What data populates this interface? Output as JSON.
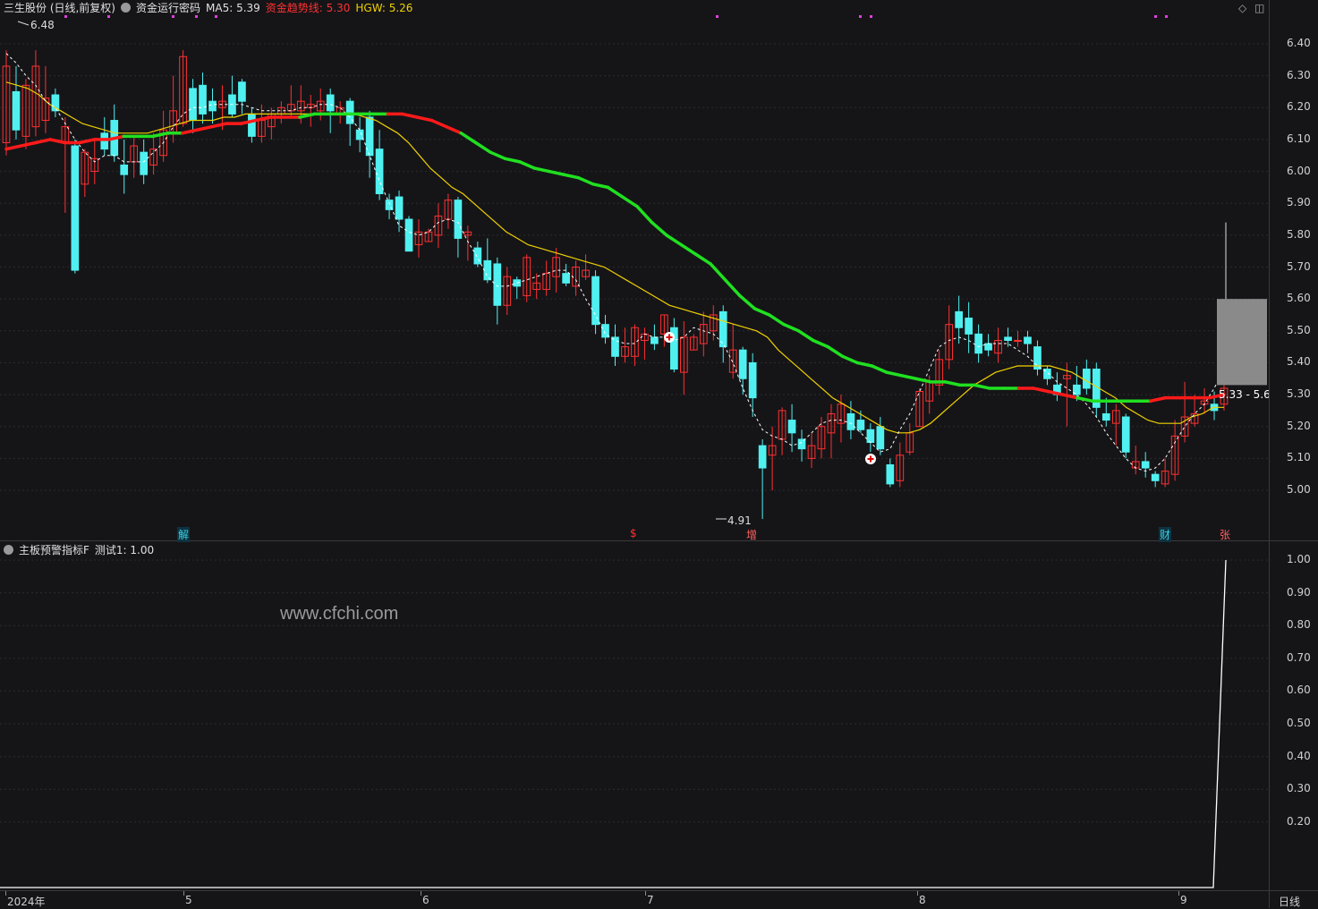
{
  "header": {
    "title": "三生股份 (日线,前复权)",
    "indicator_name": "资金运行密码",
    "ma5": "MA5: 5.39",
    "trend_line": "资金趋势线: 5.30",
    "hgw": "HGW: 5.26"
  },
  "sub_header": {
    "indicator_name": "主板预警指标F",
    "value": "测试1: 1.00"
  },
  "price_axis": [
    "6.40",
    "6.30",
    "6.20",
    "6.10",
    "6.00",
    "5.90",
    "5.80",
    "5.70",
    "5.60",
    "5.50",
    "5.40",
    "5.30",
    "5.20",
    "5.10",
    "5.00"
  ],
  "sub_axis": [
    "1.00",
    "0.90",
    "0.80",
    "0.70",
    "0.60",
    "0.50",
    "0.40",
    "0.30",
    "0.20"
  ],
  "time_axis": [
    {
      "label": "2024年",
      "month": "4"
    },
    {
      "label": "5",
      "month": "5"
    },
    {
      "label": "6",
      "month": "6"
    },
    {
      "label": "7",
      "month": "7"
    },
    {
      "label": "8",
      "month": "8"
    },
    {
      "label": "9",
      "month": "9"
    }
  ],
  "period": "日线",
  "annotations": {
    "high": "6.48",
    "low": "4.91",
    "range": "5.33 - 5.6"
  },
  "events": [
    {
      "label": "解",
      "style": "cyan"
    },
    {
      "label": "$",
      "style": "red"
    },
    {
      "label": "增",
      "style": "pink"
    },
    {
      "label": "财",
      "style": "cyan"
    },
    {
      "label": "张",
      "style": "pink"
    }
  ],
  "watermark": "www.cfchi.com",
  "colors": {
    "up": "#ff3030",
    "down": "#50f0f0",
    "trend_up": "#ff1a1a",
    "trend_down": "#20e020",
    "hgw": "#f0d000",
    "ma5": "#ffffff",
    "background": "#151518"
  },
  "chart_data": {
    "type": "candlestick",
    "y_range": [
      4.88,
      6.5
    ],
    "candles": [
      [
        6.09,
        6.33,
        6.38,
        6.05
      ],
      [
        6.25,
        6.13,
        6.33,
        6.1
      ],
      [
        6.11,
        6.27,
        6.29,
        6.07
      ],
      [
        6.14,
        6.33,
        6.38,
        6.11
      ],
      [
        6.16,
        6.23,
        6.33,
        6.12
      ],
      [
        6.24,
        6.19,
        6.26,
        6.17
      ],
      [
        6.09,
        6.14,
        6.17,
        5.87
      ],
      [
        6.08,
        5.69,
        6.1,
        5.68
      ],
      [
        5.96,
        6.06,
        6.07,
        5.92
      ],
      [
        6.0,
        6.04,
        6.1,
        5.96
      ],
      [
        6.12,
        6.07,
        6.17,
        6.05
      ],
      [
        6.16,
        6.05,
        6.21,
        6.03
      ],
      [
        6.02,
        5.99,
        6.1,
        5.93
      ],
      [
        6.03,
        6.08,
        6.11,
        5.98
      ],
      [
        6.06,
        5.99,
        6.1,
        5.96
      ],
      [
        6.02,
        6.07,
        6.12,
        5.99
      ],
      [
        6.05,
        6.13,
        6.19,
        6.03
      ],
      [
        6.12,
        6.19,
        6.3,
        6.09
      ],
      [
        6.15,
        6.36,
        6.38,
        6.14
      ],
      [
        6.26,
        6.16,
        6.29,
        6.12
      ],
      [
        6.27,
        6.18,
        6.31,
        6.15
      ],
      [
        6.22,
        6.19,
        6.26,
        6.15
      ],
      [
        6.2,
        6.22,
        6.27,
        6.13
      ],
      [
        6.24,
        6.18,
        6.3,
        6.17
      ],
      [
        6.28,
        6.22,
        6.29,
        6.18
      ],
      [
        6.18,
        6.11,
        6.2,
        6.09
      ],
      [
        6.11,
        6.16,
        6.21,
        6.09
      ],
      [
        6.14,
        6.18,
        6.2,
        6.1
      ],
      [
        6.18,
        6.2,
        6.22,
        6.15
      ],
      [
        6.19,
        6.21,
        6.27,
        6.17
      ],
      [
        6.19,
        6.22,
        6.27,
        6.15
      ],
      [
        6.2,
        6.21,
        6.24,
        6.14
      ],
      [
        6.19,
        6.22,
        6.26,
        6.16
      ],
      [
        6.24,
        6.19,
        6.26,
        6.12
      ],
      [
        6.18,
        6.2,
        6.22,
        6.15
      ],
      [
        6.22,
        6.15,
        6.23,
        6.08
      ],
      [
        6.13,
        6.1,
        6.17,
        6.06
      ],
      [
        6.17,
        6.05,
        6.19,
        5.98
      ],
      [
        6.07,
        5.93,
        6.13,
        5.91
      ],
      [
        5.91,
        5.88,
        5.93,
        5.85
      ],
      [
        5.92,
        5.85,
        5.94,
        5.81
      ],
      [
        5.85,
        5.75,
        5.86,
        5.75
      ],
      [
        5.77,
        5.81,
        5.85,
        5.73
      ],
      [
        5.78,
        5.81,
        5.82,
        5.78
      ],
      [
        5.8,
        5.86,
        5.9,
        5.76
      ],
      [
        5.85,
        5.91,
        5.93,
        5.82
      ],
      [
        5.91,
        5.79,
        5.92,
        5.73
      ],
      [
        5.8,
        5.81,
        5.83,
        5.72
      ],
      [
        5.76,
        5.71,
        5.78,
        5.7
      ],
      [
        5.72,
        5.66,
        5.79,
        5.65
      ],
      [
        5.71,
        5.58,
        5.73,
        5.52
      ],
      [
        5.58,
        5.67,
        5.7,
        5.55
      ],
      [
        5.66,
        5.64,
        5.67,
        5.6
      ],
      [
        5.61,
        5.73,
        5.74,
        5.59
      ],
      [
        5.63,
        5.65,
        5.68,
        5.6
      ],
      [
        5.63,
        5.68,
        5.72,
        5.61
      ],
      [
        5.67,
        5.73,
        5.76,
        5.62
      ],
      [
        5.68,
        5.65,
        5.71,
        5.64
      ],
      [
        5.64,
        5.7,
        5.72,
        5.61
      ],
      [
        5.67,
        5.69,
        5.74,
        5.66
      ],
      [
        5.67,
        5.52,
        5.69,
        5.49
      ],
      [
        5.52,
        5.48,
        5.55,
        5.46
      ],
      [
        5.48,
        5.42,
        5.52,
        5.39
      ],
      [
        5.42,
        5.45,
        5.51,
        5.4
      ],
      [
        5.42,
        5.51,
        5.52,
        5.39
      ],
      [
        5.47,
        5.49,
        5.51,
        5.41
      ],
      [
        5.48,
        5.46,
        5.52,
        5.44
      ],
      [
        5.49,
        5.55,
        5.55,
        5.45
      ],
      [
        5.51,
        5.38,
        5.54,
        5.37
      ],
      [
        5.37,
        5.48,
        5.53,
        5.3
      ],
      [
        5.44,
        5.48,
        5.49,
        5.44
      ],
      [
        5.46,
        5.52,
        5.56,
        5.42
      ],
      [
        5.5,
        5.55,
        5.58,
        5.47
      ],
      [
        5.56,
        5.45,
        5.58,
        5.4
      ],
      [
        5.37,
        5.44,
        5.52,
        5.35
      ],
      [
        5.44,
        5.35,
        5.45,
        5.3
      ],
      [
        5.4,
        5.29,
        5.43,
        5.23
      ],
      [
        5.14,
        5.07,
        5.16,
        4.91
      ],
      [
        5.11,
        5.14,
        5.2,
        5.0
      ],
      [
        5.16,
        5.25,
        5.26,
        5.11
      ],
      [
        5.22,
        5.18,
        5.27,
        5.12
      ],
      [
        5.16,
        5.13,
        5.19,
        5.09
      ],
      [
        5.1,
        5.14,
        5.18,
        5.07
      ],
      [
        5.13,
        5.2,
        5.23,
        5.1
      ],
      [
        5.18,
        5.24,
        5.27,
        5.1
      ],
      [
        5.21,
        5.27,
        5.3,
        5.15
      ],
      [
        5.24,
        5.19,
        5.28,
        5.16
      ],
      [
        5.22,
        5.19,
        5.25,
        5.18
      ],
      [
        5.19,
        5.15,
        5.21,
        5.12
      ],
      [
        5.2,
        5.13,
        5.23,
        5.11
      ],
      [
        5.08,
        5.02,
        5.1,
        5.01
      ],
      [
        5.03,
        5.11,
        5.15,
        5.01
      ],
      [
        5.12,
        5.18,
        5.21,
        5.11
      ],
      [
        5.2,
        5.31,
        5.32,
        5.2
      ],
      [
        5.28,
        5.34,
        5.36,
        5.24
      ],
      [
        5.33,
        5.41,
        5.44,
        5.3
      ],
      [
        5.41,
        5.52,
        5.58,
        5.38
      ],
      [
        5.56,
        5.51,
        5.61,
        5.46
      ],
      [
        5.54,
        5.49,
        5.59,
        5.43
      ],
      [
        5.49,
        5.43,
        5.52,
        5.4
      ],
      [
        5.46,
        5.44,
        5.49,
        5.42
      ],
      [
        5.43,
        5.47,
        5.51,
        5.4
      ],
      [
        5.48,
        5.47,
        5.51,
        5.45
      ],
      [
        5.47,
        5.47,
        5.5,
        5.45
      ],
      [
        5.48,
        5.46,
        5.5,
        5.43
      ],
      [
        5.45,
        5.38,
        5.47,
        5.36
      ],
      [
        5.38,
        5.35,
        5.39,
        5.33
      ],
      [
        5.33,
        5.3,
        5.37,
        5.28
      ],
      [
        5.35,
        5.36,
        5.4,
        5.2
      ],
      [
        5.33,
        5.3,
        5.39,
        5.28
      ],
      [
        5.38,
        5.32,
        5.41,
        5.3
      ],
      [
        5.38,
        5.26,
        5.4,
        5.23
      ],
      [
        5.24,
        5.22,
        5.29,
        5.2
      ],
      [
        5.21,
        5.25,
        5.27,
        5.14
      ],
      [
        5.23,
        5.12,
        5.24,
        5.1
      ],
      [
        5.07,
        5.09,
        5.14,
        5.05
      ],
      [
        5.09,
        5.07,
        5.12,
        5.04
      ],
      [
        5.05,
        5.03,
        5.06,
        5.01
      ],
      [
        5.02,
        5.06,
        5.1,
        5.01
      ],
      [
        5.05,
        5.17,
        5.22,
        5.03
      ],
      [
        5.17,
        5.23,
        5.34,
        5.15
      ],
      [
        5.21,
        5.24,
        5.3,
        5.2
      ],
      [
        5.27,
        5.28,
        5.32,
        5.24
      ],
      [
        5.27,
        5.25,
        5.31,
        5.22
      ],
      [
        5.27,
        5.32,
        5.33,
        5.25
      ]
    ],
    "ma5": [
      6.37,
      6.34,
      6.3,
      6.27,
      6.22,
      6.2,
      6.15,
      6.1,
      6.06,
      6.03,
      6.05,
      6.05,
      6.03,
      6.03,
      6.03,
      6.06,
      6.09,
      6.14,
      6.18,
      6.2,
      6.2,
      6.21,
      6.21,
      6.21,
      6.21,
      6.2,
      6.19,
      6.19,
      6.19,
      6.19,
      6.2,
      6.2,
      6.21,
      6.21,
      6.2,
      6.17,
      6.13,
      6.05,
      5.97,
      5.9,
      5.83,
      5.81,
      5.8,
      5.81,
      5.84,
      5.85,
      5.84,
      5.78,
      5.73,
      5.67,
      5.64,
      5.64,
      5.65,
      5.66,
      5.67,
      5.68,
      5.69,
      5.69,
      5.66,
      5.6,
      5.55,
      5.49,
      5.47,
      5.46,
      5.46,
      5.49,
      5.48,
      5.48,
      5.47,
      5.48,
      5.51,
      5.5,
      5.49,
      5.46,
      5.4,
      5.32,
      5.25,
      5.19,
      5.17,
      5.16,
      5.14,
      5.15,
      5.18,
      5.21,
      5.22,
      5.22,
      5.21,
      5.18,
      5.15,
      5.12,
      5.13,
      5.19,
      5.24,
      5.31,
      5.38,
      5.45,
      5.47,
      5.48,
      5.47,
      5.45,
      5.46,
      5.46,
      5.46,
      5.44,
      5.42,
      5.39,
      5.37,
      5.34,
      5.32,
      5.3,
      5.27,
      5.23,
      5.18,
      5.14,
      5.1,
      5.07,
      5.06,
      5.07,
      5.1,
      5.15,
      5.2,
      5.24,
      5.27,
      5.32,
      5.38
    ],
    "hgw": [
      6.28,
      6.27,
      6.26,
      6.24,
      6.21,
      6.19,
      6.17,
      6.15,
      6.14,
      6.13,
      6.12,
      6.12,
      6.12,
      6.12,
      6.13,
      6.14,
      6.15,
      6.16,
      6.16,
      6.16,
      6.17,
      6.17,
      6.18,
      6.18,
      6.18,
      6.18,
      6.18,
      6.18,
      6.18,
      6.18,
      6.18,
      6.18,
      6.18,
      6.17,
      6.16,
      6.14,
      6.12,
      6.09,
      6.05,
      6.01,
      5.98,
      5.95,
      5.93,
      5.9,
      5.87,
      5.84,
      5.81,
      5.79,
      5.77,
      5.76,
      5.75,
      5.74,
      5.73,
      5.72,
      5.71,
      5.7,
      5.68,
      5.66,
      5.64,
      5.62,
      5.6,
      5.58,
      5.57,
      5.56,
      5.55,
      5.54,
      5.53,
      5.52,
      5.51,
      5.5,
      5.48,
      5.44,
      5.41,
      5.38,
      5.35,
      5.32,
      5.29,
      5.27,
      5.25,
      5.23,
      5.21,
      5.19,
      5.18,
      5.18,
      5.19,
      5.21,
      5.24,
      5.27,
      5.3,
      5.33,
      5.35,
      5.37,
      5.38,
      5.39,
      5.39,
      5.39,
      5.39,
      5.38,
      5.37,
      5.35,
      5.33,
      5.31,
      5.29,
      5.26,
      5.24,
      5.22,
      5.21,
      5.21,
      5.21,
      5.23,
      5.24,
      5.26,
      5.26
    ],
    "trend": [
      6.07,
      6.08,
      6.09,
      6.1,
      6.09,
      6.09,
      6.1,
      6.1,
      6.11,
      6.11,
      6.11,
      6.12,
      6.12,
      6.13,
      6.14,
      6.15,
      6.15,
      6.16,
      6.17,
      6.17,
      6.17,
      6.18,
      6.18,
      6.18,
      6.18,
      6.18,
      6.18,
      6.18,
      6.17,
      6.16,
      6.14,
      6.12,
      6.09,
      6.06,
      6.04,
      6.03,
      6.01,
      6.0,
      5.99,
      5.98,
      5.96,
      5.95,
      5.92,
      5.89,
      5.84,
      5.8,
      5.77,
      5.74,
      5.71,
      5.66,
      5.61,
      5.57,
      5.55,
      5.52,
      5.5,
      5.47,
      5.45,
      5.42,
      5.4,
      5.39,
      5.37,
      5.36,
      5.35,
      5.34,
      5.34,
      5.33,
      5.33,
      5.32,
      5.32,
      5.32,
      5.32,
      5.31,
      5.3,
      5.29,
      5.28,
      5.28,
      5.28,
      5.28,
      5.28,
      5.29,
      5.29,
      5.29,
      5.29,
      5.3
    ],
    "trend_up_segments": [
      [
        0,
        8
      ],
      [
        12,
        20
      ],
      [
        26,
        31
      ],
      [
        69,
        73
      ],
      [
        78,
        84
      ]
    ],
    "test1": [
      0,
      0,
      0,
      0,
      0,
      0,
      0,
      0,
      0,
      0,
      1
    ]
  }
}
